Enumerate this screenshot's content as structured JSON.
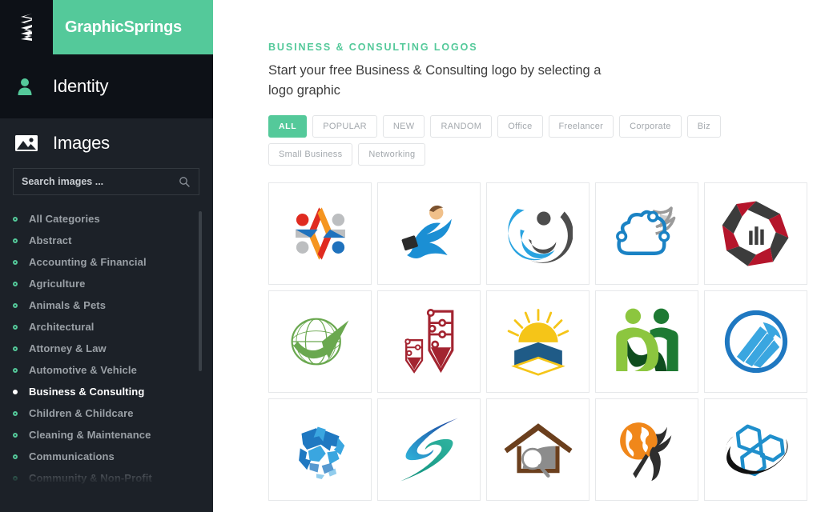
{
  "brand": {
    "logo_icon": "spring-zigzag-icon",
    "name": "GraphicSprings"
  },
  "sidebar": {
    "nav": [
      {
        "label": "Identity",
        "icon": "person-icon"
      },
      {
        "label": "Images",
        "icon": "image-icon"
      }
    ],
    "search": {
      "placeholder": "Search images ...",
      "value": "",
      "icon": "search-icon"
    },
    "categories": [
      {
        "label": "All Categories",
        "active": false
      },
      {
        "label": "Abstract",
        "active": false
      },
      {
        "label": "Accounting & Financial",
        "active": false
      },
      {
        "label": "Agriculture",
        "active": false
      },
      {
        "label": "Animals & Pets",
        "active": false
      },
      {
        "label": "Architectural",
        "active": false
      },
      {
        "label": "Attorney & Law",
        "active": false
      },
      {
        "label": "Automotive & Vehicle",
        "active": false
      },
      {
        "label": "Business & Consulting",
        "active": true
      },
      {
        "label": "Children & Childcare",
        "active": false
      },
      {
        "label": "Cleaning & Maintenance",
        "active": false
      },
      {
        "label": "Communications",
        "active": false
      },
      {
        "label": "Community & Non-Profit",
        "active": false
      }
    ]
  },
  "main": {
    "eyebrow": "BUSINESS & CONSULTING LOGOS",
    "lede": "Start your free Business & Consulting logo by selecting a logo graphic",
    "tags": [
      {
        "label": "ALL",
        "active": true
      },
      {
        "label": "POPULAR",
        "active": false
      },
      {
        "label": "NEW",
        "active": false
      },
      {
        "label": "RANDOM",
        "active": false
      },
      {
        "label": "Office",
        "active": false
      },
      {
        "label": "Freelancer",
        "active": false
      },
      {
        "label": "Corporate",
        "active": false
      },
      {
        "label": "Biz",
        "active": false
      },
      {
        "label": "Small Business",
        "active": false
      },
      {
        "label": "Networking",
        "active": false
      }
    ],
    "logos": [
      {
        "name": "people-star-circle-logo",
        "colors": [
          "#e02b20",
          "#f59520",
          "#1f72bd",
          "#bcbec0"
        ]
      },
      {
        "name": "running-graduate-person-logo",
        "colors": [
          "#1b8fd4",
          "#f0c08a",
          "#7a5230",
          "#2b2b2b"
        ]
      },
      {
        "name": "swoosh-person-crescent-logo",
        "colors": [
          "#29a3e0",
          "#4d4d4d"
        ]
      },
      {
        "name": "cloud-network-bird-logo",
        "colors": [
          "#1a82c4",
          "#9a9a9a"
        ]
      },
      {
        "name": "red-black-pinwheel-bars-logo",
        "colors": [
          "#b5152b",
          "#3c3c3c"
        ]
      },
      {
        "name": "green-globe-arrow-logo",
        "colors": [
          "#6aa84f"
        ]
      },
      {
        "name": "red-circuit-arrows-logo",
        "colors": [
          "#a32430"
        ]
      },
      {
        "name": "sunrise-open-book-logo",
        "colors": [
          "#f5c518",
          "#1f5b87"
        ]
      },
      {
        "name": "two-green-people-logo",
        "colors": [
          "#8cc63f",
          "#1e7a33",
          "#0f4d1e"
        ]
      },
      {
        "name": "blue-circle-growth-bars-logo",
        "colors": [
          "#1f78c1",
          "#3aa6e0"
        ]
      },
      {
        "name": "blue-puzzle-globe-logo",
        "colors": [
          "#1f78c1",
          "#3aa6e0"
        ]
      },
      {
        "name": "blue-green-swoosh-s-logo",
        "colors": [
          "#1b3f9e",
          "#0f8f7a"
        ]
      },
      {
        "name": "house-magnifier-roof-logo",
        "colors": [
          "#6b3f1d",
          "#8c8c8c"
        ]
      },
      {
        "name": "orange-globe-runner-logo",
        "colors": [
          "#f0871a",
          "#2e2e2e"
        ]
      },
      {
        "name": "hexagon-cluster-orbit-logo",
        "colors": [
          "#1f8fcc",
          "#000000"
        ]
      }
    ]
  },
  "colors": {
    "accent_green": "#54c99a",
    "sidebar_dark": "#1c2128",
    "sidebar_darker": "#0d1117",
    "text_muted": "#9aa0a6"
  }
}
